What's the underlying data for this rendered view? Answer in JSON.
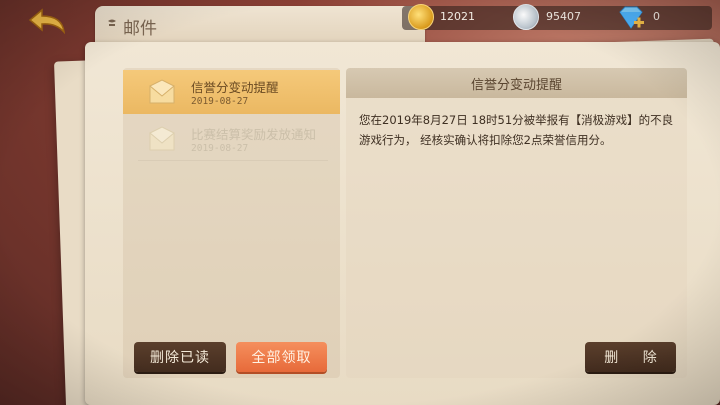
{
  "header": {
    "title": "邮件",
    "back_icon": "back-arrow-icon"
  },
  "currencies": [
    {
      "icon": "gold-coin-icon",
      "value": "12021",
      "color": "#e2a327"
    },
    {
      "icon": "silver-coin-icon",
      "value": "95407",
      "color": "#b9c3cc"
    },
    {
      "icon": "diamond-add-icon",
      "value": "0",
      "color": "#4fb6ff"
    }
  ],
  "mail_list": [
    {
      "subject": "信誉分变动提醒",
      "date": "2019-08-27",
      "selected": true
    },
    {
      "subject": "比赛结算奖励发放通知",
      "date": "2019-08-27",
      "selected": false
    }
  ],
  "left_buttons": {
    "delete_read": "删除已读",
    "claim_all": "全部领取"
  },
  "detail": {
    "title": "信誉分变动提醒",
    "body": "您在2019年8月27日 18时51分被举报有【消极游戏】的不良游戏行为， 经核实确认将扣除您2点荣誉信用分。",
    "delete_label": "删 除"
  },
  "colors": {
    "selected_item": "#f0c06e",
    "orange_button": "#ec7442",
    "dark_button": "#4f3524",
    "background": "#8a3f34"
  }
}
